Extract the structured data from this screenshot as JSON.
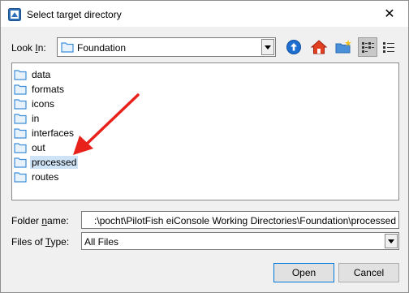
{
  "window": {
    "title": "Select target directory",
    "close_symbol": "✕"
  },
  "look_in": {
    "label_pre": "Look ",
    "label_mnemonic": "I",
    "label_post": "n:",
    "value": "Foundation"
  },
  "toolbar": {
    "buttons": [
      "up-one-level",
      "home",
      "create-new-folder",
      "list-view",
      "details-view"
    ],
    "active": "list-view"
  },
  "files": [
    {
      "name": "data",
      "selected": false
    },
    {
      "name": "formats",
      "selected": false
    },
    {
      "name": "icons",
      "selected": false
    },
    {
      "name": "in",
      "selected": false
    },
    {
      "name": "interfaces",
      "selected": false
    },
    {
      "name": "out",
      "selected": false
    },
    {
      "name": "processed",
      "selected": true
    },
    {
      "name": "routes",
      "selected": false
    }
  ],
  "folder_name": {
    "label_pre": "Folder ",
    "label_mnemonic": "n",
    "label_post": "ame:",
    "value": ":\\pocht\\PilotFish eiConsole Working Directories\\Foundation\\processed"
  },
  "files_of_type": {
    "label_pre": "Files of ",
    "label_mnemonic": "T",
    "label_post": "ype:",
    "value": "All Files"
  },
  "buttons": {
    "open": "Open",
    "cancel": "Cancel"
  },
  "colors": {
    "accent": "#0078d7",
    "selection": "#cfe3f7",
    "arrow": "#e8221b",
    "folder": "#3c8ed8"
  }
}
